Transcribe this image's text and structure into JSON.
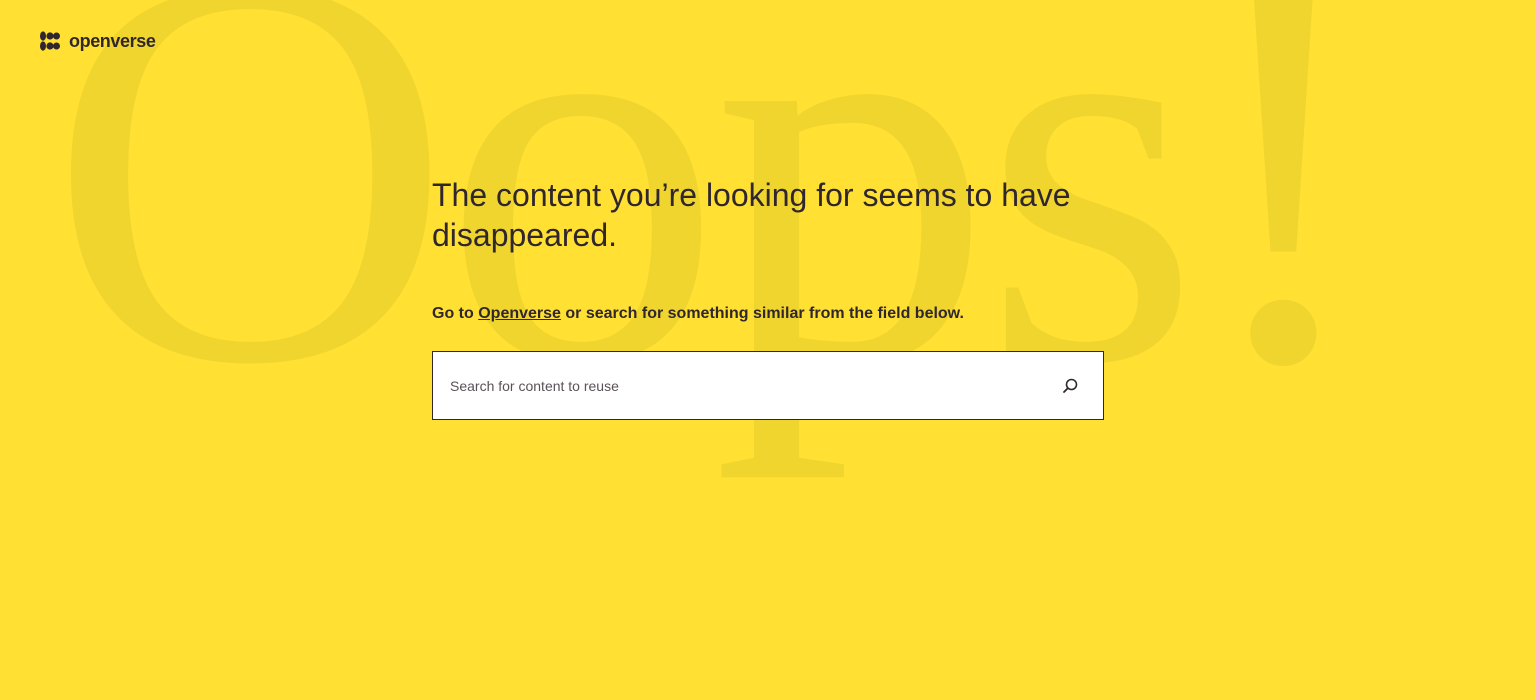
{
  "background": {
    "text": "Oops!",
    "color": "#FFE033",
    "text_color": "#F0D52E"
  },
  "header": {
    "logo_icon": "openverse-logo-icon",
    "logo_text": "openverse"
  },
  "main": {
    "headline": "The content you’re looking for seems to have disappeared.",
    "subline_prefix": "Go to ",
    "subline_link": "Openverse",
    "subline_suffix": " or search for something similar from the field below."
  },
  "search": {
    "placeholder": "Search for content to reuse",
    "value": "",
    "button_icon": "search-icon"
  },
  "colors": {
    "text": "#30272E",
    "accent": "#FFE033",
    "input_bg": "#FFFFFF"
  }
}
